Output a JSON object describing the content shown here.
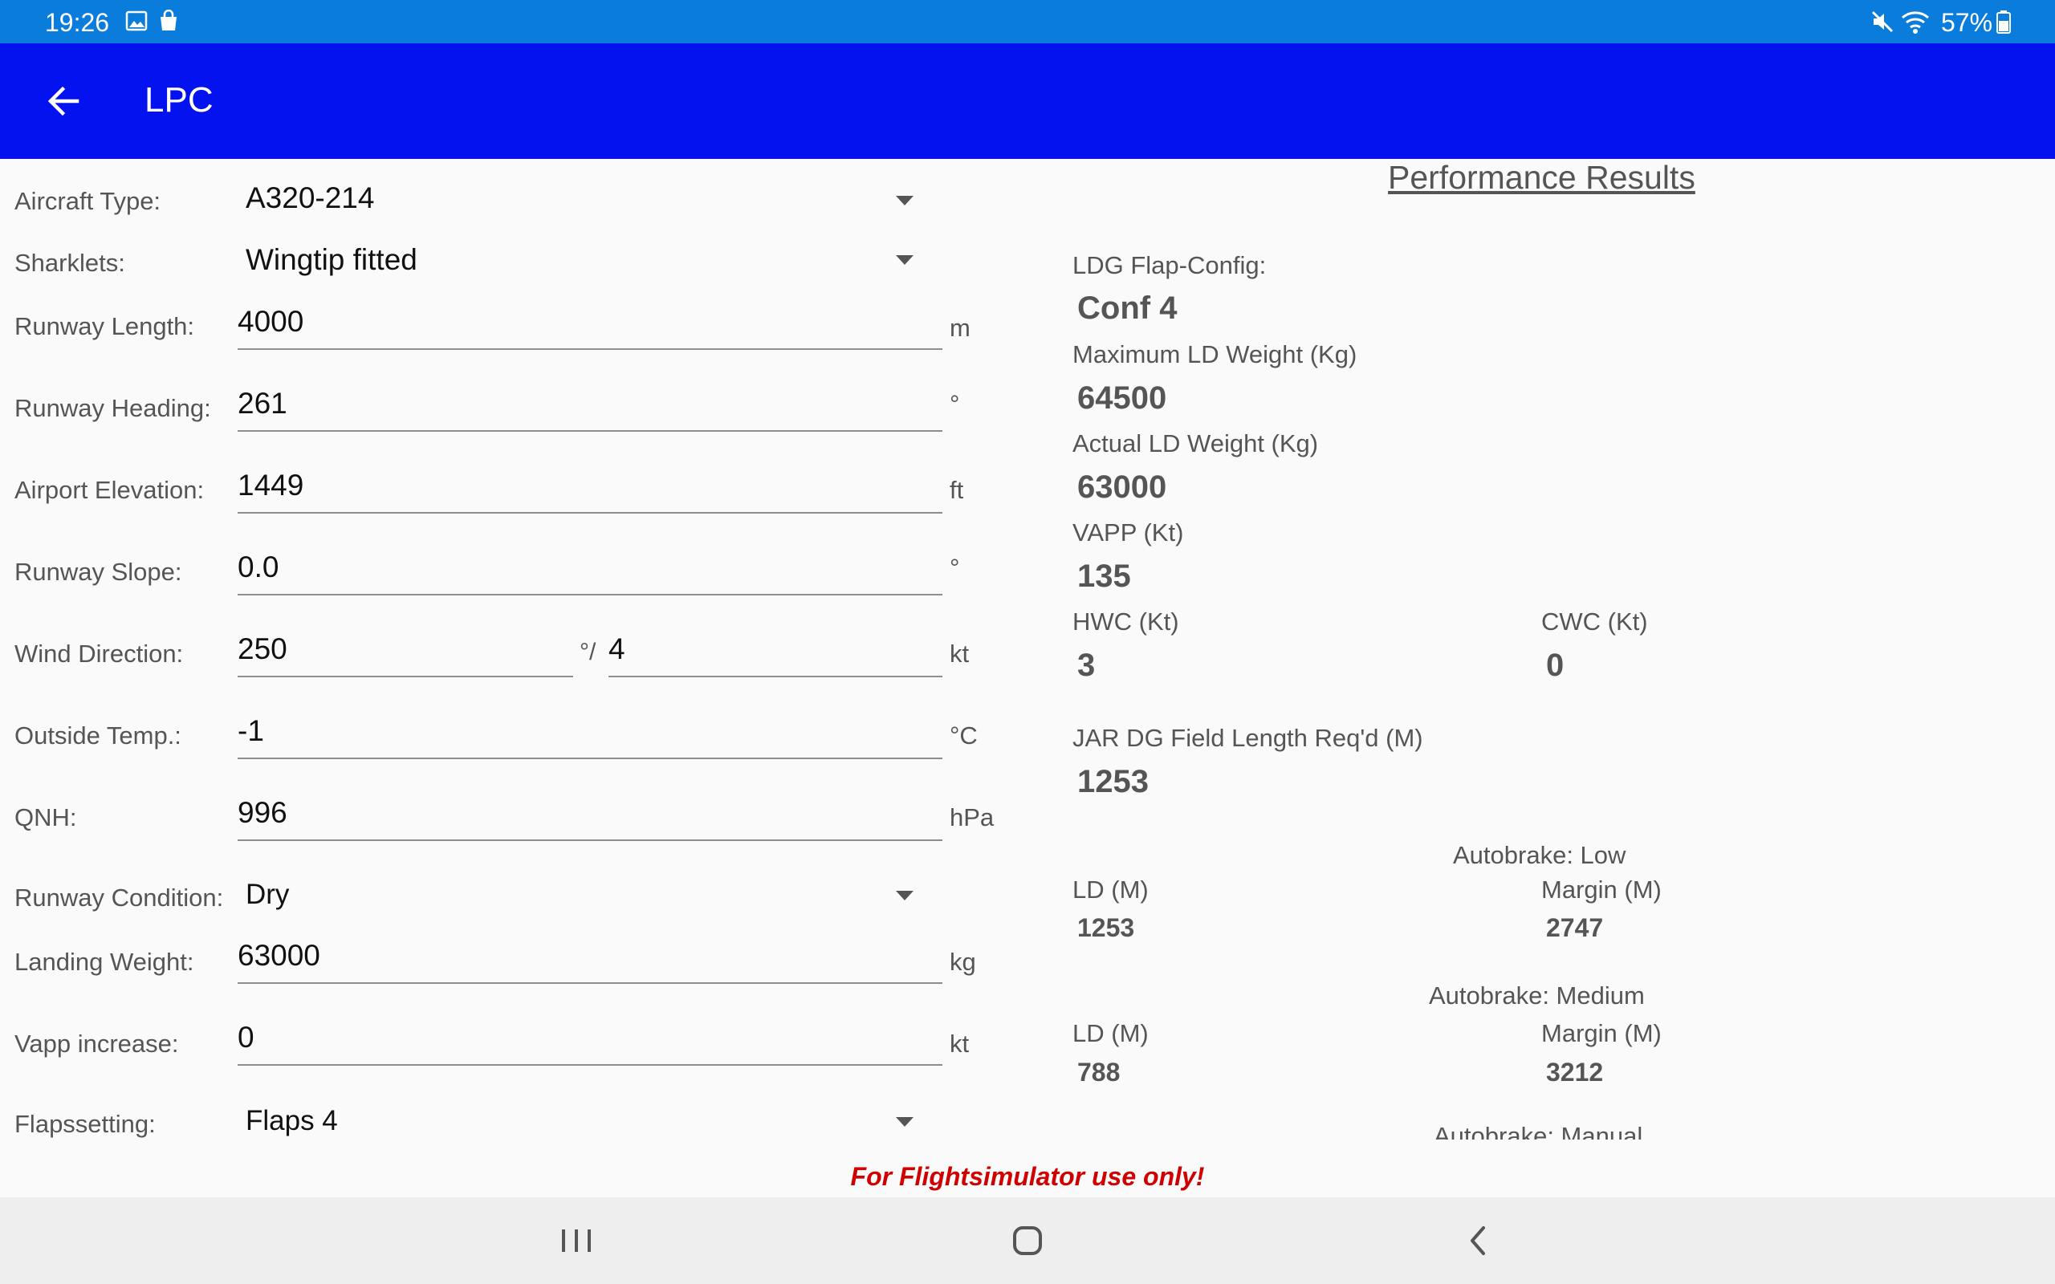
{
  "status_bar": {
    "time": "19:26",
    "battery": "57%"
  },
  "app_bar": {
    "title": "LPC"
  },
  "form": {
    "aircraft_type": {
      "label": "Aircraft Type:",
      "value": "A320-214"
    },
    "sharklets": {
      "label": "Sharklets:",
      "value": "Wingtip fitted"
    },
    "runway_length": {
      "label": "Runway Length:",
      "value": "4000",
      "unit": "m"
    },
    "runway_heading": {
      "label": "Runway Heading:",
      "value": "261",
      "unit": "°"
    },
    "airport_elevation": {
      "label": "Airport Elevation:",
      "value": "1449",
      "unit": "ft"
    },
    "runway_slope": {
      "label": "Runway Slope:",
      "value": "0.0",
      "unit": "°"
    },
    "wind": {
      "label": "Wind Direction:",
      "direction": "250",
      "separator": "°/",
      "speed": "4",
      "unit": "kt"
    },
    "outside_temp": {
      "label": "Outside Temp.:",
      "value": "-1",
      "unit": "°C"
    },
    "qnh": {
      "label": "QNH:",
      "value": "996",
      "unit": "hPa"
    },
    "runway_condition": {
      "label": "Runway Condition:",
      "value": "Dry"
    },
    "landing_weight": {
      "label": "Landing Weight:",
      "value": "63000",
      "unit": "kg"
    },
    "vapp_increase": {
      "label": "Vapp increase:",
      "value": "0",
      "unit": "kt"
    },
    "flapsetting": {
      "label": "Flapssetting:",
      "value": "Flaps 4"
    }
  },
  "results": {
    "title": "Performance Results",
    "ldg_flap_config": {
      "label": "LDG Flap-Config:",
      "value": "Conf 4"
    },
    "max_ld_weight": {
      "label": "Maximum LD Weight (Kg)",
      "value": "64500"
    },
    "actual_ld_weight": {
      "label": "Actual LD Weight (Kg)",
      "value": "63000"
    },
    "vapp": {
      "label": "VAPP (Kt)",
      "value": "135"
    },
    "hwc": {
      "label": "HWC (Kt)",
      "value": "3"
    },
    "cwc": {
      "label": "CWC (Kt)",
      "value": "0"
    },
    "field_length": {
      "label": "JAR DG Field Length Req'd (M)",
      "value": "1253"
    },
    "autobrake": [
      {
        "title": "Autobrake: Low",
        "ld_label": "LD (M)",
        "ld_value": "1253",
        "margin_label": "Margin (M)",
        "margin_value": "2747"
      },
      {
        "title": "Autobrake: Medium",
        "ld_label": "LD (M)",
        "ld_value": "788",
        "margin_label": "Margin (M)",
        "margin_value": "3212"
      },
      {
        "title": "Autobrake: Manual"
      }
    ]
  },
  "disclaimer": "For Flightsimulator use only!",
  "icons": [
    "image-icon",
    "shopping-bag-icon",
    "mute-icon",
    "wifi-icon",
    "battery-icon",
    "back-arrow-icon",
    "dropdown-caret-icon",
    "recents-icon",
    "home-icon",
    "nav-back-icon"
  ]
}
